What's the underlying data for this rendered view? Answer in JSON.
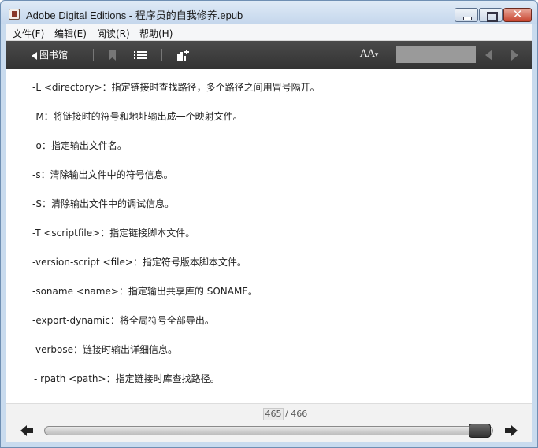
{
  "window": {
    "title": "Adobe Digital Editions - 程序员的自我修养.epub",
    "close_glyph": "✕"
  },
  "menu": [
    "文件(F)",
    "编辑(E)",
    "阅读(R)",
    "帮助(H)"
  ],
  "toolbar": {
    "library_label": "图书馆",
    "font_size_label": "AA",
    "search_value": "",
    "icons": [
      "bookmark-icon",
      "toc-list-icon",
      "add-view-icon",
      "font-size-icon",
      "prev-page-icon",
      "next-page-icon"
    ]
  },
  "content": {
    "lines": [
      "-L <directory>：指定链接时查找路径，多个路径之间用冒号隔开。",
      "-M：将链接时的符号和地址输出成一个映射文件。",
      "-o：指定输出文件名。",
      "-s：清除输出文件中的符号信息。",
      "-S：清除输出文件中的调试信息。",
      "-T <scriptfile>：指定链接脚本文件。",
      "-version-script <file>：指定符号版本脚本文件。",
      "-soname <name>：指定输出共享库的 SONAME。",
      "-export-dynamic：将全局符号全部导出。",
      "-verbose：链接时输出详细信息。",
      " - rpath <path>：指定链接时库查找路径。"
    ]
  },
  "pager": {
    "current_page": "465",
    "total_label": "/ 466",
    "progress": 0.998
  },
  "colors": {
    "toolbar_bg": "#3d3d3d",
    "window_frame": "#c9dbee"
  }
}
